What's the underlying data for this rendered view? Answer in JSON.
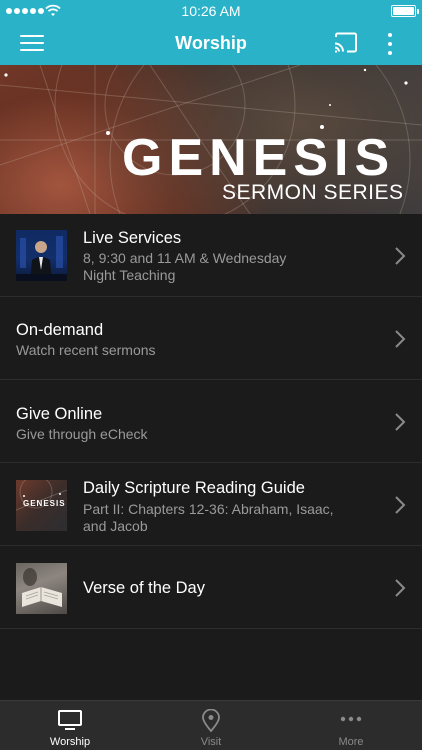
{
  "status_bar": {
    "time": "10:26 AM"
  },
  "nav": {
    "title": "Worship"
  },
  "banner": {
    "title": "GENESIS",
    "subtitle": "SERMON SERIES"
  },
  "list": {
    "items": [
      {
        "title": "Live Services",
        "subtitle_line1": "8, 9:30 and 11 AM & Wednesday",
        "subtitle_line2": "Night Teaching"
      },
      {
        "title": "On-demand",
        "subtitle_line1": "Watch recent sermons"
      },
      {
        "title": "Give Online",
        "subtitle_line1": "Give through eCheck"
      },
      {
        "title": "Daily Scripture Reading Guide",
        "subtitle_line1": "Part II: Chapters 12-36: Abraham, Isaac,",
        "subtitle_line2": "and Jacob",
        "thumb_text": "GENESIS"
      },
      {
        "title": "Verse of the Day"
      }
    ]
  },
  "tab_bar": {
    "tabs": [
      {
        "label": "Worship",
        "icon": "tv-icon",
        "active": true
      },
      {
        "label": "Visit",
        "icon": "location-pin-icon",
        "active": false
      },
      {
        "label": "More",
        "icon": "ellipsis-icon",
        "active": false
      }
    ]
  },
  "colors": {
    "accent": "#2ab3c8",
    "background": "#1b1b1b",
    "tab_bar": "#2c2c2c",
    "secondary_text": "#9a9a9a",
    "inactive_tab": "#8a8a8a"
  }
}
